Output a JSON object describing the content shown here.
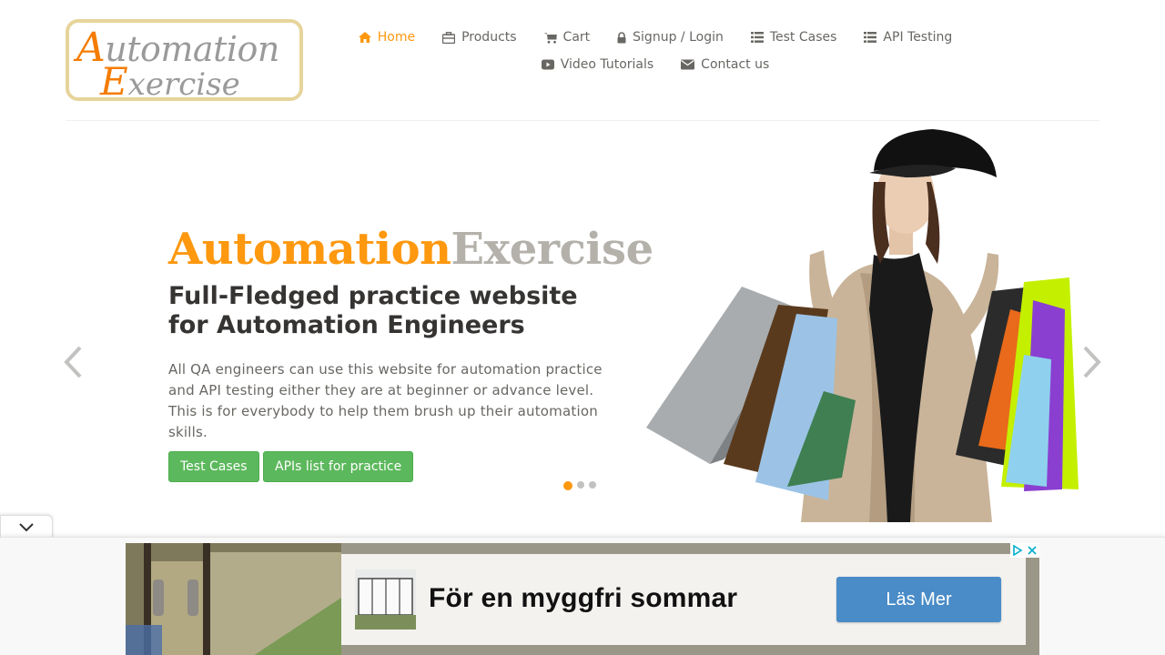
{
  "logo": {
    "line1_cap": "A",
    "line1_rest": "utomation",
    "line2_cap": "E",
    "line2_rest": "xercise"
  },
  "nav": {
    "row1": [
      {
        "label": "Home",
        "icon": "home-icon",
        "active": true
      },
      {
        "label": "Products",
        "icon": "briefcase-icon",
        "active": false
      },
      {
        "label": "Cart",
        "icon": "cart-icon",
        "active": false
      },
      {
        "label": "Signup / Login",
        "icon": "lock-icon",
        "active": false
      },
      {
        "label": "Test Cases",
        "icon": "list-icon",
        "active": false
      },
      {
        "label": "API Testing",
        "icon": "list-icon",
        "active": false
      }
    ],
    "row2": [
      {
        "label": "Video Tutorials",
        "icon": "youtube-icon",
        "active": false
      },
      {
        "label": "Contact us",
        "icon": "envelope-icon",
        "active": false
      }
    ]
  },
  "hero": {
    "brand_a": "Automation",
    "brand_b": "Exercise",
    "title": "Full-Fledged practice website for Automation Engineers",
    "text": "All QA engineers can use this website for automation practice and API testing either they are at beginner or advance level. This is for everybody to help them brush up their automation skills.",
    "buttons": [
      "Test Cases",
      "APIs list for practice"
    ],
    "active_slide": 1,
    "slide_count": 3
  },
  "ad": {
    "headline": "För en myggfri sommar",
    "cta": "Läs Mer"
  },
  "colors": {
    "accent": "#fe980f",
    "button": "#5cb85c",
    "text": "#696763",
    "heading": "#363432",
    "ad_cta": "#4a8cc8"
  }
}
